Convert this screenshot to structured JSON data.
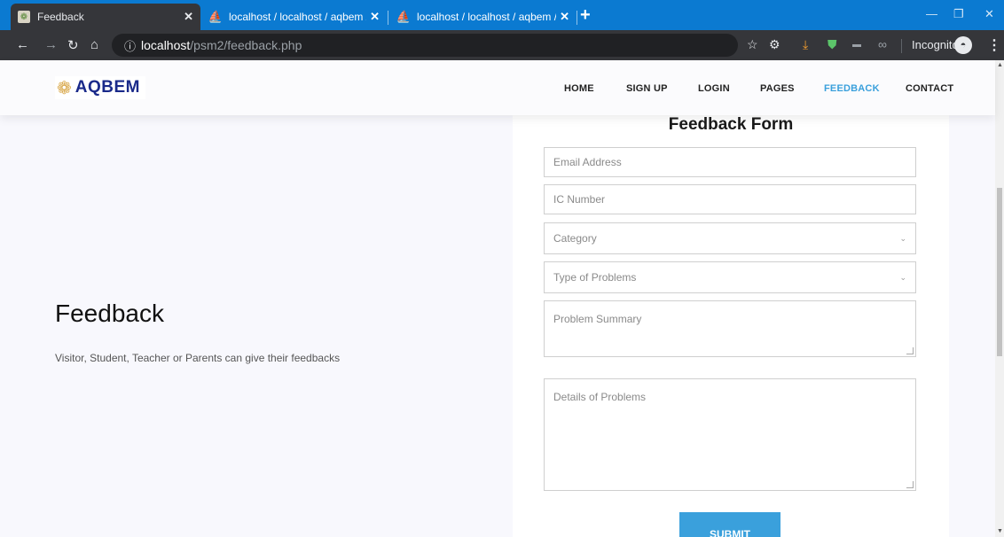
{
  "browser": {
    "tabs": [
      {
        "title": "Feedback",
        "active": true
      },
      {
        "title": "localhost / localhost / aqbem / st",
        "active": false
      },
      {
        "title": "localhost / localhost / aqbem / st",
        "active": false
      }
    ],
    "new_tab": "+",
    "url_host": "localhost",
    "url_path": "/psm2/feedback.php",
    "incognito_label": "Incognito",
    "icons": [
      "back-icon",
      "forward-icon",
      "reload-icon",
      "home-icon",
      "info-icon",
      "star-icon",
      "download-icon",
      "shield-icon",
      "infinity-icon",
      "incognito-icon",
      "menu-icon"
    ]
  },
  "site": {
    "brand": "AQBEM",
    "nav": [
      {
        "label": "HOME",
        "active": false
      },
      {
        "label": "SIGN UP",
        "active": false
      },
      {
        "label": "LOGIN",
        "active": false
      },
      {
        "label": "PAGES",
        "active": false
      },
      {
        "label": "FEEDBACK",
        "active": true
      },
      {
        "label": "CONTACT",
        "active": false
      }
    ],
    "accent": "#3aa0dc"
  },
  "hero": {
    "title": "Feedback",
    "subtitle": "Visitor, Student, Teacher or Parents can give their feedbacks"
  },
  "form": {
    "title": "Feedback Form",
    "email_placeholder": "Email Address",
    "ic_placeholder": "IC Number",
    "category_placeholder": "Category",
    "problem_type_placeholder": "Type of Problems",
    "summary_placeholder": "Problem Summary",
    "details_placeholder": "Details of Problems",
    "submit_label": "SUBMIT"
  }
}
